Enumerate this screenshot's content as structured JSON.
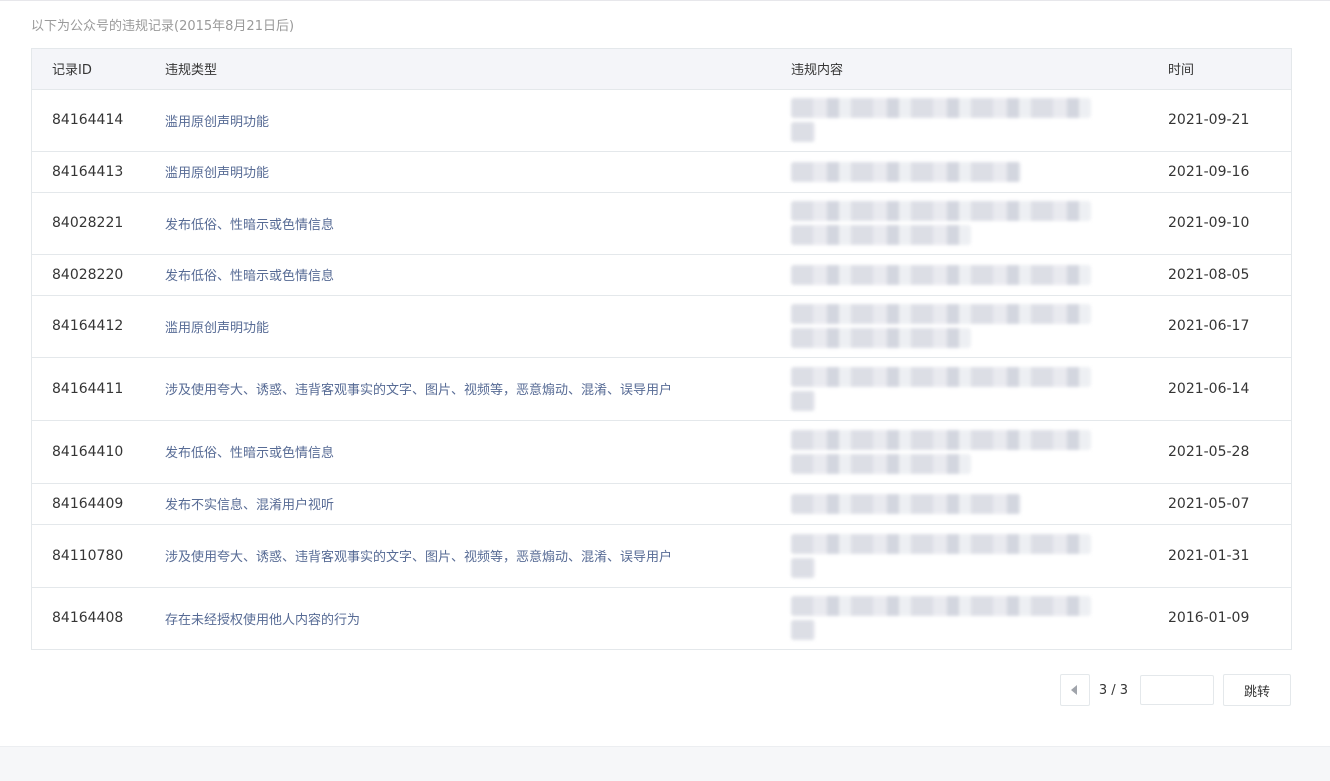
{
  "notice": "以下为公众号的违规记录(2015年8月21日后)",
  "table": {
    "headers": [
      "记录ID",
      "违规类型",
      "违规内容",
      "时间"
    ],
    "rows": [
      {
        "id": "84164414",
        "type": "滥用原创声明功能",
        "time": "2021-09-21"
      },
      {
        "id": "84164413",
        "type": "滥用原创声明功能",
        "time": "2021-09-16"
      },
      {
        "id": "84028221",
        "type": "发布低俗、性暗示或色情信息",
        "time": "2021-09-10"
      },
      {
        "id": "84028220",
        "type": "发布低俗、性暗示或色情信息",
        "time": "2021-08-05"
      },
      {
        "id": "84164412",
        "type": "滥用原创声明功能",
        "time": "2021-06-17"
      },
      {
        "id": "84164411",
        "type": "涉及使用夸大、诱惑、违背客观事实的文字、图片、视频等，恶意煽动、混淆、误导用户",
        "time": "2021-06-14"
      },
      {
        "id": "84164410",
        "type": "发布低俗、性暗示或色情信息",
        "time": "2021-05-28"
      },
      {
        "id": "84164409",
        "type": "发布不实信息、混淆用户视听",
        "time": "2021-05-07"
      },
      {
        "id": "84110780",
        "type": "涉及使用夸大、诱惑、违背客观事实的文字、图片、视频等，恶意煽动、混淆、误导用户",
        "time": "2021-01-31"
      },
      {
        "id": "84164408",
        "type": "存在未经授权使用他人内容的行为",
        "time": "2016-01-09"
      }
    ]
  },
  "pager": {
    "current_total": "3 / 3",
    "input_value": "",
    "go_label": "跳转",
    "prev_icon": "triangle-left-icon"
  }
}
